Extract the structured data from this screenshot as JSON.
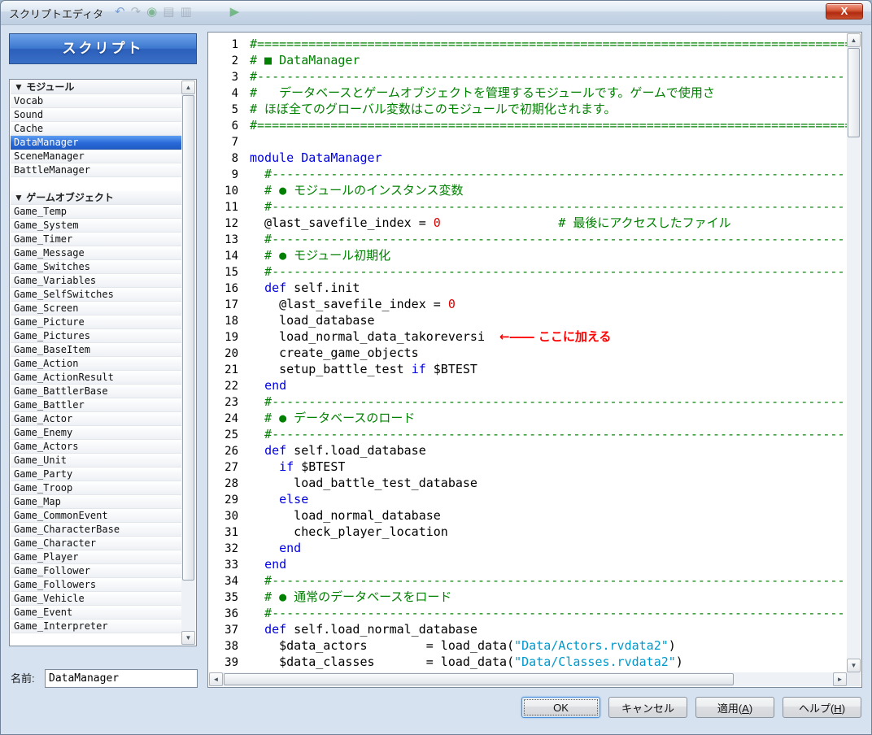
{
  "window": {
    "title": "スクリプトエディタ",
    "close_glyph": "X"
  },
  "titlebar": {
    "ghost_icons": [
      {
        "name": "undo-icon",
        "glyph": "↶",
        "color": "#2f6bb5"
      },
      {
        "name": "redo-icon",
        "glyph": "↷",
        "color": "#8a94a0"
      },
      {
        "name": "globe-icon",
        "glyph": "◉",
        "color": "#3f9b4f"
      },
      {
        "name": "database-icon",
        "glyph": "▤",
        "color": "#8a94a0"
      },
      {
        "name": "resource-icon",
        "glyph": "▥",
        "color": "#8a94a0"
      },
      {
        "name": "playtest-icon",
        "glyph": "▶",
        "color": "#2e9e3a"
      }
    ]
  },
  "sidebar": {
    "header": "スクリプト",
    "name_label": "名前:",
    "name_value": "DataManager",
    "items": [
      {
        "type": "header",
        "label": "▼ モジュール"
      },
      {
        "type": "item",
        "label": "Vocab"
      },
      {
        "type": "item",
        "label": "Sound"
      },
      {
        "type": "item",
        "label": "Cache"
      },
      {
        "type": "item",
        "label": "DataManager",
        "selected": true
      },
      {
        "type": "item",
        "label": "SceneManager"
      },
      {
        "type": "item",
        "label": "BattleManager"
      },
      {
        "type": "spacer",
        "label": ""
      },
      {
        "type": "header",
        "label": "▼ ゲームオブジェクト"
      },
      {
        "type": "item",
        "label": "Game_Temp"
      },
      {
        "type": "item",
        "label": "Game_System"
      },
      {
        "type": "item",
        "label": "Game_Timer"
      },
      {
        "type": "item",
        "label": "Game_Message"
      },
      {
        "type": "item",
        "label": "Game_Switches"
      },
      {
        "type": "item",
        "label": "Game_Variables"
      },
      {
        "type": "item",
        "label": "Game_SelfSwitches"
      },
      {
        "type": "item",
        "label": "Game_Screen"
      },
      {
        "type": "item",
        "label": "Game_Picture"
      },
      {
        "type": "item",
        "label": "Game_Pictures"
      },
      {
        "type": "item",
        "label": "Game_BaseItem"
      },
      {
        "type": "item",
        "label": "Game_Action"
      },
      {
        "type": "item",
        "label": "Game_ActionResult"
      },
      {
        "type": "item",
        "label": "Game_BattlerBase"
      },
      {
        "type": "item",
        "label": "Game_Battler"
      },
      {
        "type": "item",
        "label": "Game_Actor"
      },
      {
        "type": "item",
        "label": "Game_Enemy"
      },
      {
        "type": "item",
        "label": "Game_Actors"
      },
      {
        "type": "item",
        "label": "Game_Unit"
      },
      {
        "type": "item",
        "label": "Game_Party"
      },
      {
        "type": "item",
        "label": "Game_Troop"
      },
      {
        "type": "item",
        "label": "Game_Map"
      },
      {
        "type": "item",
        "label": "Game_CommonEvent"
      },
      {
        "type": "item",
        "label": "Game_CharacterBase"
      },
      {
        "type": "item",
        "label": "Game_Character"
      },
      {
        "type": "item",
        "label": "Game_Player"
      },
      {
        "type": "item",
        "label": "Game_Follower"
      },
      {
        "type": "item",
        "label": "Game_Followers"
      },
      {
        "type": "item",
        "label": "Game_Vehicle"
      },
      {
        "type": "item",
        "label": "Game_Event"
      },
      {
        "type": "item",
        "label": "Game_Interpreter"
      }
    ]
  },
  "editor": {
    "colors": {
      "comment": "#008000",
      "keyword": "#0000e6",
      "number": "#e00000",
      "string": "#0099cc",
      "plain": "#000000",
      "annotation": "#ff0000",
      "selection_bg": "#2a6ad8"
    },
    "lines": [
      [
        [
          "#==============================================================================================",
          "c"
        ]
      ],
      [
        [
          "# ■ DataManager",
          "c"
        ]
      ],
      [
        [
          "#----------------------------------------------------------------------------------------------",
          "c"
        ]
      ],
      [
        [
          "#   データベースとゲームオブジェクトを管理するモジュールです。ゲームで使用さ",
          "c"
        ]
      ],
      [
        [
          "# ほぼ全てのグローバル変数はこのモジュールで初期化されます。",
          "c"
        ]
      ],
      [
        [
          "#==============================================================================================",
          "c"
        ]
      ],
      [],
      [
        [
          "module DataManager",
          "k"
        ]
      ],
      [
        [
          "  #--------------------------------------------------------------------------------------------",
          "c"
        ]
      ],
      [
        [
          "  # ● モジュールのインスタンス変数",
          "c"
        ]
      ],
      [
        [
          "  #--------------------------------------------------------------------------------------------",
          "c"
        ]
      ],
      [
        [
          "  @last_savefile_index = ",
          "p"
        ],
        [
          "0",
          "n"
        ],
        [
          "                ",
          "p"
        ],
        [
          "# 最後にアクセスしたファイル",
          "c"
        ]
      ],
      [
        [
          "  #--------------------------------------------------------------------------------------------",
          "c"
        ]
      ],
      [
        [
          "  # ● モジュール初期化",
          "c"
        ]
      ],
      [
        [
          "  #--------------------------------------------------------------------------------------------",
          "c"
        ]
      ],
      [
        [
          "  ",
          "p"
        ],
        [
          "def",
          "k"
        ],
        [
          " self.init",
          "p"
        ]
      ],
      [
        [
          "    @last_savefile_index = ",
          "p"
        ],
        [
          "0",
          "n"
        ]
      ],
      [
        [
          "    load_database",
          "p"
        ]
      ],
      [
        [
          "    load_normal_data_takoreversi",
          "p"
        ],
        [
          "  ",
          "p"
        ],
        [
          "←―― ここに加える",
          "a"
        ]
      ],
      [
        [
          "    create_game_objects",
          "p"
        ]
      ],
      [
        [
          "    setup_battle_test ",
          "p"
        ],
        [
          "if",
          "k"
        ],
        [
          " $BTEST",
          "p"
        ]
      ],
      [
        [
          "  ",
          "p"
        ],
        [
          "end",
          "k"
        ]
      ],
      [
        [
          "  #--------------------------------------------------------------------------------------------",
          "c"
        ]
      ],
      [
        [
          "  # ● データベースのロード",
          "c"
        ]
      ],
      [
        [
          "  #--------------------------------------------------------------------------------------------",
          "c"
        ]
      ],
      [
        [
          "  ",
          "p"
        ],
        [
          "def",
          "k"
        ],
        [
          " self.load_database",
          "p"
        ]
      ],
      [
        [
          "    ",
          "p"
        ],
        [
          "if",
          "k"
        ],
        [
          " $BTEST",
          "p"
        ]
      ],
      [
        [
          "      load_battle_test_database",
          "p"
        ]
      ],
      [
        [
          "    ",
          "p"
        ],
        [
          "else",
          "k"
        ]
      ],
      [
        [
          "      load_normal_database",
          "p"
        ]
      ],
      [
        [
          "      check_player_location",
          "p"
        ]
      ],
      [
        [
          "    ",
          "p"
        ],
        [
          "end",
          "k"
        ]
      ],
      [
        [
          "  ",
          "p"
        ],
        [
          "end",
          "k"
        ]
      ],
      [
        [
          "  #--------------------------------------------------------------------------------------------",
          "c"
        ]
      ],
      [
        [
          "  # ● 通常のデータベースをロード",
          "c"
        ]
      ],
      [
        [
          "  #--------------------------------------------------------------------------------------------",
          "c"
        ]
      ],
      [
        [
          "  ",
          "p"
        ],
        [
          "def",
          "k"
        ],
        [
          " self.load_normal_database",
          "p"
        ]
      ],
      [
        [
          "    $data_actors        = load_data(",
          "p"
        ],
        [
          "\"Data/Actors.rvdata2\"",
          "s"
        ],
        [
          ")",
          "p"
        ]
      ],
      [
        [
          "    $data_classes       = load_data(",
          "p"
        ],
        [
          "\"Data/Classes.rvdata2\"",
          "s"
        ],
        [
          ")",
          "p"
        ]
      ]
    ]
  },
  "buttons": [
    {
      "name": "ok-button",
      "pre": "OK",
      "key": "",
      "post": "",
      "default": true
    },
    {
      "name": "cancel-button",
      "pre": "キャンセル",
      "key": "",
      "post": ""
    },
    {
      "name": "apply-button",
      "pre": "適用(",
      "key": "A",
      "post": ")"
    },
    {
      "name": "help-button",
      "pre": "ヘルプ(",
      "key": "H",
      "post": ")"
    }
  ]
}
